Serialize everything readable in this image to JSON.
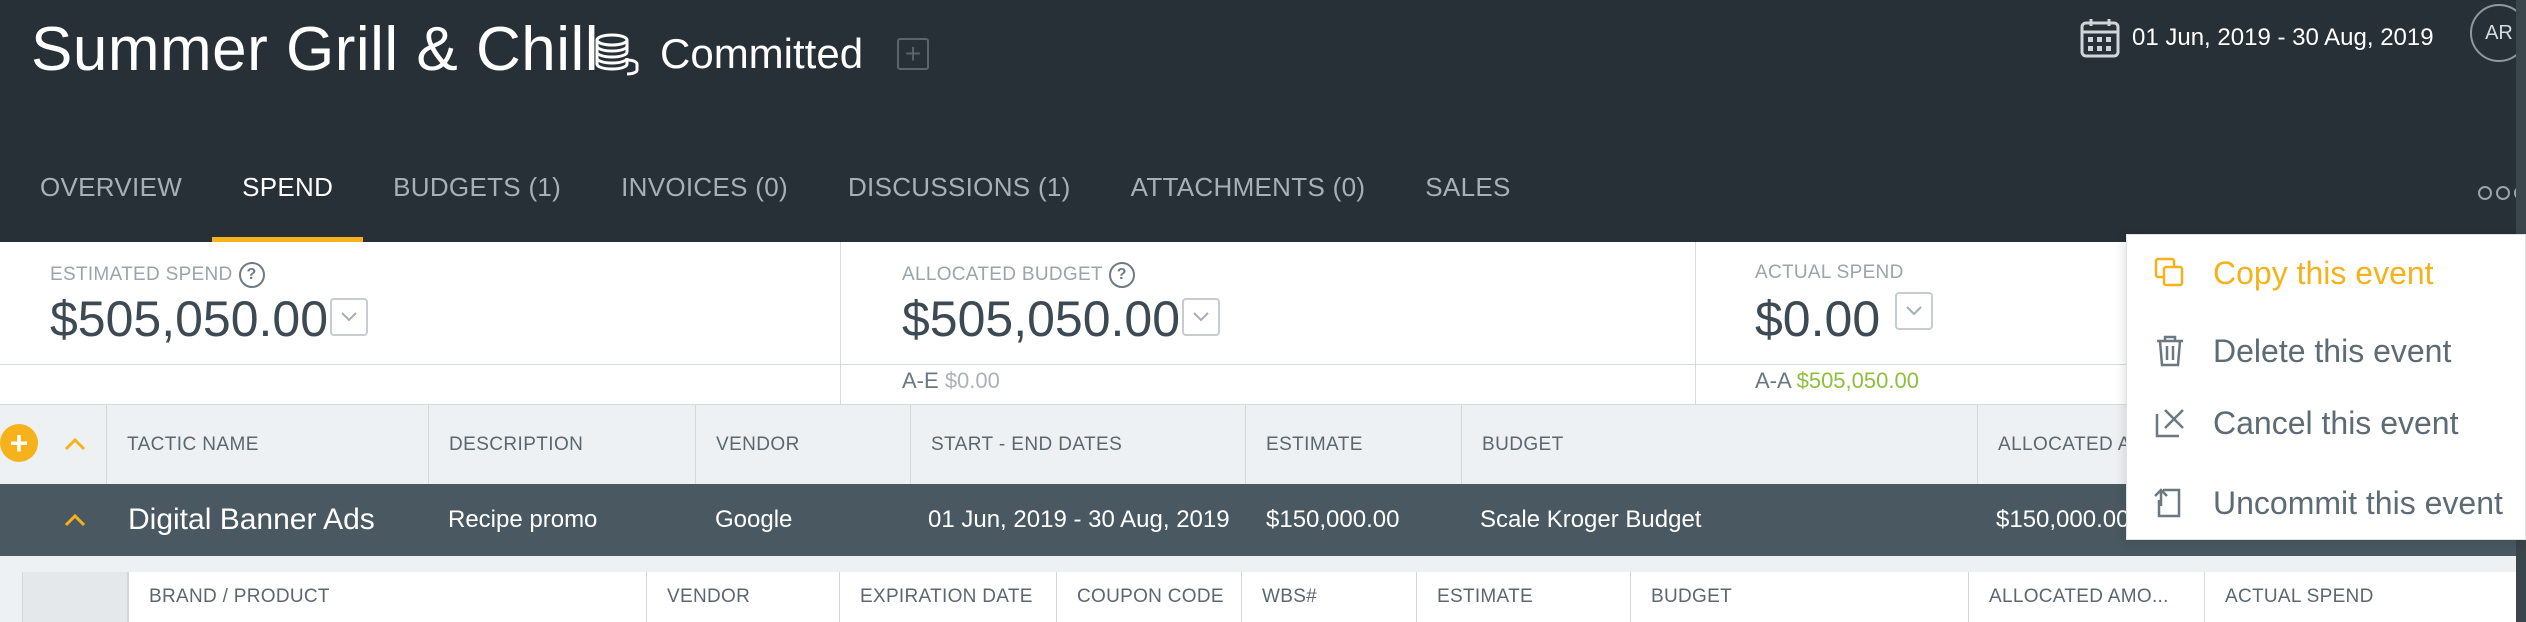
{
  "header": {
    "title": "Summer Grill & Chill",
    "status": "Committed",
    "date_range": "01 Jun, 2019 - 30 Aug, 2019",
    "avatar_initials": "AR"
  },
  "tabs": [
    {
      "label": "OVERVIEW"
    },
    {
      "label": "SPEND"
    },
    {
      "label": "BUDGETS (1)"
    },
    {
      "label": "INVOICES (0)"
    },
    {
      "label": "DISCUSSIONS (1)"
    },
    {
      "label": "ATTACHMENTS (0)"
    },
    {
      "label": "SALES"
    }
  ],
  "summary": {
    "estimated": {
      "label": "ESTIMATED SPEND",
      "help": "?",
      "amount": "$505,050.00"
    },
    "allocated": {
      "label": "ALLOCATED BUDGET",
      "help": "?",
      "amount": "$505,050.00",
      "sub_label": "A-E",
      "sub_value": "$0.00"
    },
    "actual": {
      "label": "ACTUAL SPEND",
      "amount": "$0.00",
      "sub_label": "A-A",
      "sub_value": "$505,050.00"
    }
  },
  "table": {
    "add_symbol": "+",
    "columns": [
      "TACTIC NAME",
      "DESCRIPTION",
      "VENDOR",
      "START - END DATES",
      "ESTIMATE",
      "BUDGET",
      "ALLOCATED A"
    ],
    "row": {
      "tactic_name": "Digital Banner Ads",
      "description": "Recipe promo",
      "vendor": "Google",
      "dates": "01 Jun, 2019 - 30 Aug, 2019",
      "estimate": "$150,000.00",
      "budget": "Scale Kroger Budget",
      "allocated": "$150,000.00"
    },
    "sub_columns": [
      "BRAND / PRODUCT",
      "VENDOR",
      "EXPIRATION DATE",
      "COUPON CODE",
      "WBS#",
      "ESTIMATE",
      "BUDGET",
      "ALLOCATED AMO...",
      "ACTUAL SPEND"
    ]
  },
  "menu": {
    "items": [
      {
        "label": "Copy this event",
        "icon": "copy-icon"
      },
      {
        "label": "Delete this event",
        "icon": "trash-icon"
      },
      {
        "label": "Cancel this event",
        "icon": "cancel-icon"
      },
      {
        "label": "Uncommit this event",
        "icon": "uncommit-icon"
      }
    ]
  },
  "colors": {
    "header_bg": "#273036",
    "accent": "#f5b21b",
    "row_bg": "#4a5961",
    "positive": "#8ec03d"
  }
}
